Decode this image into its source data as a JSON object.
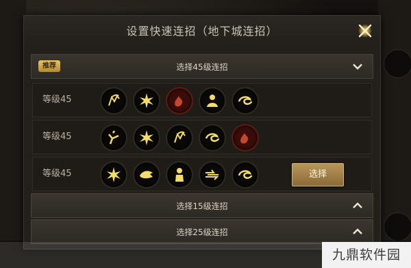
{
  "dialog": {
    "title": "设置快速连招（地下城连招）"
  },
  "sections": [
    {
      "label": "选择45级连招",
      "badge": "推荐",
      "expanded": true
    },
    {
      "label": "选择15级连招",
      "expanded": false
    },
    {
      "label": "选择25级连招",
      "expanded": false
    }
  ],
  "combos": [
    {
      "level_label": "等级45",
      "skills": [
        "warrior-skill-icon",
        "burst-skill-icon",
        "blood-skill-icon",
        "summon-skill-icon",
        "whirl-skill-icon"
      ]
    },
    {
      "level_label": "等级45",
      "skills": [
        "kick-skill-icon",
        "burst-skill-icon",
        "warrior-skill-icon",
        "whirl-skill-icon",
        "blood-skill-icon"
      ]
    },
    {
      "level_label": "等级45",
      "skills": [
        "burst-skill-icon",
        "dragon-skill-icon",
        "monk-skill-icon",
        "dash-skill-icon",
        "whirl-skill-icon"
      ],
      "select_label": "选择"
    }
  ],
  "watermark": "九鼎软件园",
  "colors": {
    "accent_gold": "#b8955a",
    "badge_gold": "#e7c56a",
    "skill_glow": "#f2dc6a",
    "blood_red": "#3b0d0a"
  }
}
